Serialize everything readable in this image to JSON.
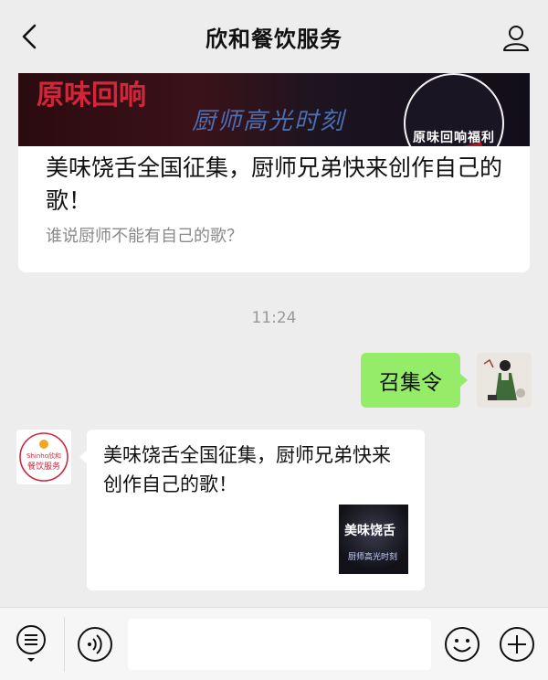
{
  "header": {
    "title": "欣和餐饮服务"
  },
  "article": {
    "banner_logo_main": "原味回响",
    "banner_logo_small": "原",
    "banner_center_text": "厨师高光时刻",
    "banner_badge_text": "原味回响福利",
    "title": "美味饶舌全国征集，厨师兄弟快来创作自己的歌！",
    "description": "谁说厨师不能有自己的歌？"
  },
  "timestamp": "11:24",
  "outgoing": {
    "text": "召集令"
  },
  "incoming": {
    "avatar_brand_text": "Shinho欣和",
    "avatar_brand_sub": "餐饮服务",
    "text": "美味饶舌全国征集，厨师兄弟快来创作自己的歌！",
    "thumb_title": "美味饶舌",
    "thumb_subtitle": "厨师高光时刻"
  },
  "input": {
    "placeholder": ""
  },
  "colors": {
    "outgoing_bubble": "#95ec69",
    "background": "#ededed",
    "brand_red": "#d3263a"
  },
  "icons": {
    "back": "chevron-left-icon",
    "profile": "person-icon",
    "menu": "menu-list-icon",
    "voice": "voice-icon",
    "emoji": "emoji-icon",
    "plus": "plus-icon"
  }
}
